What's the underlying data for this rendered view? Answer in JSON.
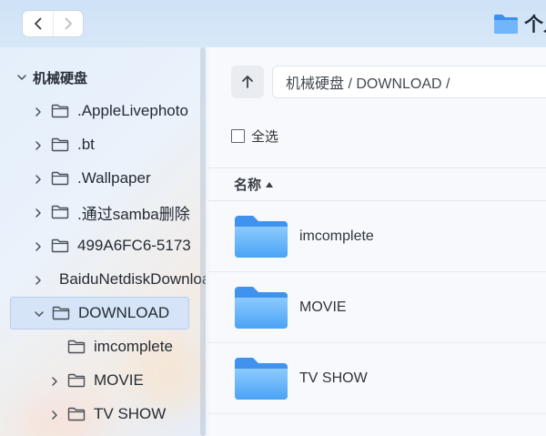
{
  "titlebar": {
    "title": "个人",
    "back_icon": "chevron-left-icon",
    "forward_icon": "chevron-right-icon",
    "folder_icon": "folder-icon"
  },
  "sidebar": {
    "root_label": "机械硬盘",
    "items": [
      {
        "label": ".AppleLivephoto",
        "expandable": true
      },
      {
        "label": ".bt",
        "expandable": true
      },
      {
        "label": ".Wallpaper",
        "expandable": true
      },
      {
        "label": ".通过samba删除",
        "expandable": true
      },
      {
        "label": "499A6FC6-5173",
        "expandable": true
      },
      {
        "label": "BaiduNetdiskDownload",
        "expandable": true
      },
      {
        "label": "DOWNLOAD",
        "expandable": true,
        "expanded": true,
        "selected": true
      },
      {
        "label": "imcomplete",
        "expandable": false,
        "child": true
      },
      {
        "label": "MOVIE",
        "expandable": true,
        "child": true
      },
      {
        "label": "TV SHOW",
        "expandable": true,
        "child": true
      }
    ]
  },
  "toolbar": {
    "up_icon": "arrow-up-icon",
    "path": "机械硬盘 / DOWNLOAD /",
    "select_all_label": "全选"
  },
  "list": {
    "header_name": "名称",
    "sort_direction": "ascending",
    "rows": [
      {
        "name": "imcomplete",
        "icon": "folder-icon"
      },
      {
        "name": "MOVIE",
        "icon": "folder-icon"
      },
      {
        "name": "TV SHOW",
        "icon": "folder-icon"
      }
    ]
  },
  "colors": {
    "accent": "#4a9bf0",
    "folder_light": "#7cc0fb",
    "folder_dark": "#3d8ff0",
    "selected_bg": "#d5e4f7"
  }
}
